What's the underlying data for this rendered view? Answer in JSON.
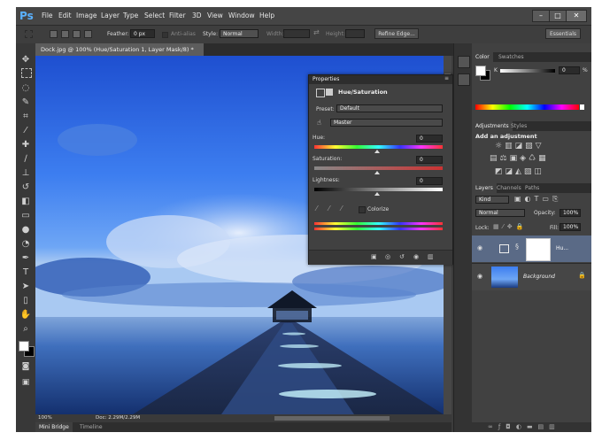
{
  "app": {
    "logo": "Ps",
    "workspace": "Essentials"
  },
  "menu": [
    "File",
    "Edit",
    "Image",
    "Layer",
    "Type",
    "Select",
    "Filter",
    "3D",
    "View",
    "Window",
    "Help"
  ],
  "window_controls": {
    "minimize": "–",
    "maximize": "□",
    "close": "✕"
  },
  "options": {
    "feather_label": "Feather:",
    "feather_value": "0 px",
    "antialias_label": "Anti-alias",
    "style_label": "Style:",
    "style_value": "Normal",
    "width_label": "Width:",
    "height_label": "Height:",
    "refine_edge": "Refine Edge..."
  },
  "document": {
    "tab_title": "Dock.jpg @ 100% (Hue/Saturation 1, Layer Mask/8) *",
    "tab_close": "×"
  },
  "status": {
    "zoom": "100%",
    "doc_size": "Doc: 2.29M/2.29M"
  },
  "bottom_tabs": [
    "Mini Bridge",
    "Timeline"
  ],
  "properties": {
    "panel_title": "Properties",
    "adjustment_name": "Hue/Saturation",
    "preset_label": "Preset:",
    "preset_value": "Default",
    "channel_value": "Master",
    "hue_label": "Hue:",
    "hue_value": "0",
    "saturation_label": "Saturation:",
    "saturation_value": "0",
    "lightness_label": "Lightness:",
    "lightness_value": "0",
    "colorize_label": "Colorize"
  },
  "color_panel": {
    "tabs": [
      "Color",
      "Swatches"
    ],
    "k_label": "K",
    "k_value": "0",
    "k_unit": "%"
  },
  "adjustments_panel": {
    "tabs": [
      "Adjustments",
      "Styles"
    ],
    "heading": "Add an adjustment"
  },
  "layers_panel": {
    "tabs": [
      "Layers",
      "Channels",
      "Paths"
    ],
    "kind_label": "Kind",
    "blend_mode": "Normal",
    "opacity_label": "Opacity:",
    "opacity_value": "100%",
    "lock_label": "Lock:",
    "fill_label": "Fill:",
    "fill_value": "100%",
    "layers": [
      {
        "name": "Hu..."
      },
      {
        "name": "Background"
      }
    ]
  },
  "colors": {
    "accent": "#5ab1ff",
    "panel": "#414141",
    "selected_layer": "#5a6a86"
  }
}
